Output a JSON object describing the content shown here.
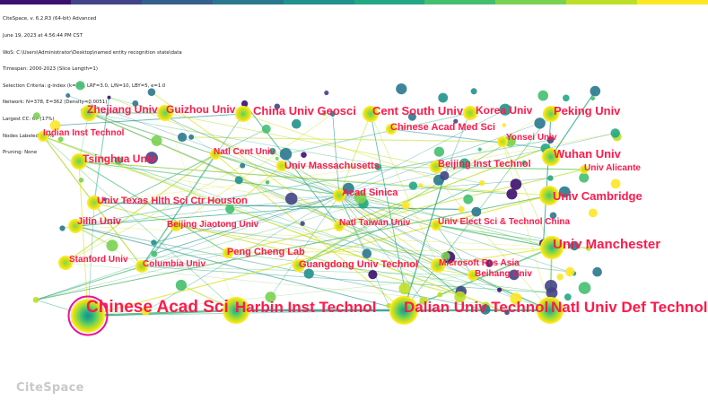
{
  "app": {
    "logo_text": "CiteSpace",
    "meta_lines": [
      "CiteSpace, v. 6.2.R3 (64-bit) Advanced",
      "June 19, 2023 at 4:56:44 PM CST",
      "WoS: C:\\Users\\Administrator\\Desktop\\named entity recognition state\\data",
      "Timespan: 2000-2023 (Slice Length=1)",
      "Selection Criteria: g-index (k=25), LRF=3.0, L/N=10, LBY=5, e=1.0",
      "Network: N=378, E=362 (Density=0.0051)",
      "Largest CC: 67 (17%)",
      "Nodes Labeled: 1.0%",
      "Pruning: None"
    ]
  },
  "colors": {
    "label": "#ff1a4b",
    "timeline": [
      "#3b0f70",
      "#414487",
      "#355f8d",
      "#2a788e",
      "#21918c",
      "#22a884",
      "#44bf70",
      "#7ad151",
      "#bddf26",
      "#fde725"
    ],
    "burst_ring": "#e8139a"
  },
  "nodes": [
    {
      "id": "chinese-acad-sci",
      "label": "Chinese Acad Sci",
      "size": "xl",
      "ring": true
    },
    {
      "id": "harbin-inst-technol",
      "label": "Harbin Inst Technol",
      "size": "l"
    },
    {
      "id": "dalian-univ-technol",
      "label": "Dalian Univ Technol",
      "size": "l"
    },
    {
      "id": "natl-univ-def-technol",
      "label": "Natl Univ Def Technol",
      "size": "l"
    },
    {
      "id": "univ-manchester",
      "label": "Univ Manchester",
      "size": "l"
    },
    {
      "id": "zhejiang-univ",
      "label": "Zhejiang Univ",
      "size": "m"
    },
    {
      "id": "guizhou-univ",
      "label": "Guizhou Univ",
      "size": "m"
    },
    {
      "id": "china-univ-geosci",
      "label": "China Univ Geosci",
      "size": "m"
    },
    {
      "id": "cent-south-univ",
      "label": "Cent South Univ",
      "size": "m"
    },
    {
      "id": "korea-univ",
      "label": "Korea Univ",
      "size": "m"
    },
    {
      "id": "peking-univ",
      "label": "Peking Univ",
      "size": "m"
    },
    {
      "id": "indian-inst-technol",
      "label": "Indian Inst Technol",
      "size": "s"
    },
    {
      "id": "chinese-acad-med-sci",
      "label": "Chinese Acad Med Sci",
      "size": "s"
    },
    {
      "id": "yonsei-univ",
      "label": "Yonsei Univ",
      "size": "s"
    },
    {
      "id": "natl-cent-univ",
      "label": "Natl Cent Univ",
      "size": "s"
    },
    {
      "id": "tsinghua-univ",
      "label": "Tsinghua Univ",
      "size": "m"
    },
    {
      "id": "wuhan-univ",
      "label": "Wuhan Univ",
      "size": "m"
    },
    {
      "id": "univ-massachusetts",
      "label": "Univ Massachusetts",
      "size": "s"
    },
    {
      "id": "beijing-inst-technol",
      "label": "Beijing Inst Technol",
      "size": "s"
    },
    {
      "id": "univ-alicante",
      "label": "Univ Alicante",
      "size": "s"
    },
    {
      "id": "univ-texas-hlth-sci-ctr-houston",
      "label": "Univ Texas Hlth Sci Ctr Houston",
      "size": "s"
    },
    {
      "id": "acad-sinica",
      "label": "Acad Sinica",
      "size": "s"
    },
    {
      "id": "univ-cambridge",
      "label": "Univ Cambridge",
      "size": "m"
    },
    {
      "id": "jilin-univ",
      "label": "Jilin Univ",
      "size": "s"
    },
    {
      "id": "beijing-jiaotong-univ",
      "label": "Beijing Jiaotong Univ",
      "size": "s"
    },
    {
      "id": "natl-taiwan-univ",
      "label": "Natl Taiwan Univ",
      "size": "s"
    },
    {
      "id": "univ-elect-sci-technol-china",
      "label": "Univ Elect Sci & Technol China",
      "size": "s"
    },
    {
      "id": "stanford-univ",
      "label": "Stanford Univ",
      "size": "s"
    },
    {
      "id": "columbia-univ",
      "label": "Columbia Univ",
      "size": "s"
    },
    {
      "id": "peng-cheng-lab",
      "label": "Peng Cheng Lab",
      "size": "s"
    },
    {
      "id": "guangdong-univ-technol",
      "label": "Guangdong Univ Technol",
      "size": "s"
    },
    {
      "id": "microsoft-res-asia",
      "label": "Microsoft Res Asia",
      "size": "s"
    },
    {
      "id": "beihang-univ",
      "label": "Beihang Univ",
      "size": "s"
    }
  ]
}
